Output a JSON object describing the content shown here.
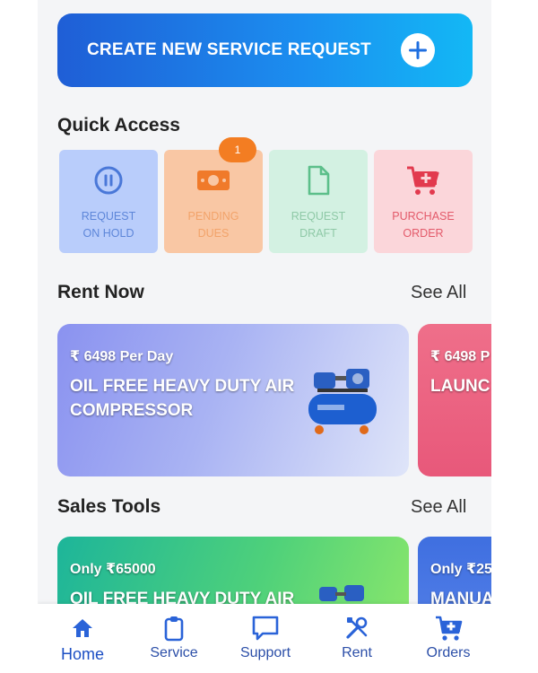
{
  "colors": {
    "brand_blue": "#1f5ed6",
    "tab_icon": "#2a63d8",
    "screen_bg": "#f4f5f7"
  },
  "cta": {
    "label": "CREATE NEW SERVICE REQUEST",
    "icon": "plus-circle-icon"
  },
  "quick_access": {
    "title": "Quick Access",
    "items": [
      {
        "line1": "REQUEST",
        "line2": "ON HOLD",
        "icon": "pause-circle-icon",
        "bg": "#b9cdfb",
        "fg": "#4a78d8"
      },
      {
        "line1": "PENDING",
        "line2": "DUES",
        "icon": "cash-icon",
        "bg": "#f9c7a4",
        "fg": "#f2a36a",
        "badge": "1"
      },
      {
        "line1": "REQUEST",
        "line2": "DRAFT",
        "icon": "document-icon",
        "bg": "#d3f1e2",
        "fg": "#8fc9a7"
      },
      {
        "line1": "PURCHASE",
        "line2": "ORDER",
        "icon": "cart-icon",
        "bg": "#fbd6da",
        "fg": "#e35a6a"
      }
    ]
  },
  "rent_now": {
    "title": "Rent Now",
    "see_all": "See All",
    "cards": [
      {
        "price": "₹ 6498 Per Day",
        "name": "OIL FREE HEAVY DUTY AIR COMPRESSOR"
      },
      {
        "price": "₹ 6498 P",
        "name": "LAUNC"
      }
    ]
  },
  "sales_tools": {
    "title": "Sales Tools",
    "see_all": "See All",
    "cards": [
      {
        "price": "Only ₹65000",
        "name": "OIL FREE HEAVY DUTY AIR"
      },
      {
        "price": "Only ₹25",
        "name": "MANUA"
      }
    ]
  },
  "tabs": [
    {
      "label": "Home",
      "icon": "home-icon",
      "active": true
    },
    {
      "label": "Service",
      "icon": "clipboard-icon",
      "active": false
    },
    {
      "label": "Support",
      "icon": "chat-icon",
      "active": false
    },
    {
      "label": "Rent",
      "icon": "tools-icon",
      "active": false
    },
    {
      "label": "Orders",
      "icon": "cart-plus-icon",
      "active": false
    }
  ]
}
